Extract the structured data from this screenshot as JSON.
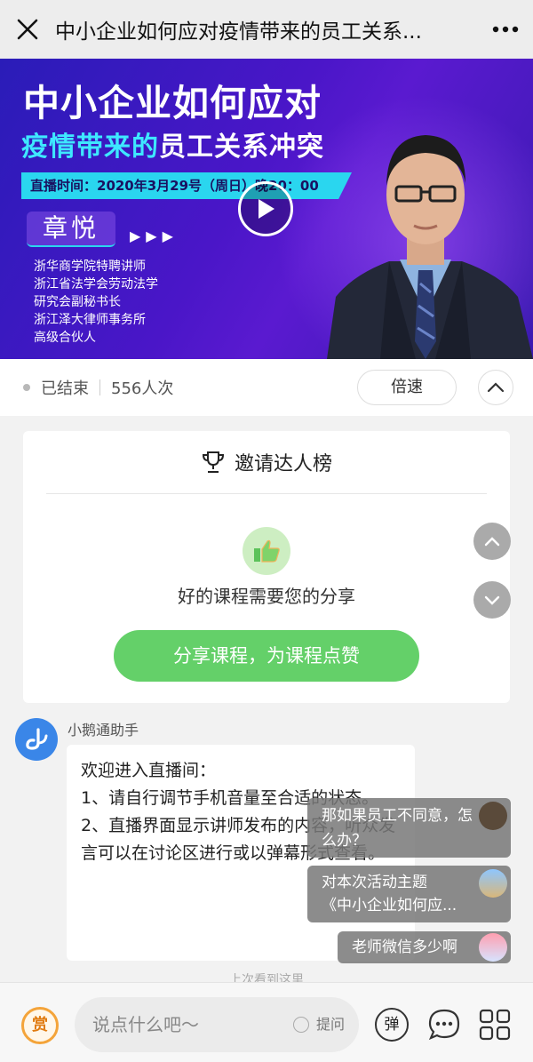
{
  "topbar": {
    "title": "中小企业如何应对疫情带来的员工关系..."
  },
  "banner": {
    "title_line1": "中小企业如何应对",
    "title_line2_highlight": "疫情带来的",
    "title_line2_rest": "员工关系冲突",
    "live_time": "直播时间：2020年3月29号（周日）晚20：00",
    "speaker_name": "章悦",
    "arrows": "▶▶▶",
    "speaker_titles": [
      "浙华商学院特聘讲师",
      "浙江省法学会劳动法学",
      "研究会副秘书长",
      "浙江泽大律师事务所",
      "高级合伙人"
    ]
  },
  "status": {
    "state": "已结束",
    "views": "556人次",
    "speed_label": "倍速"
  },
  "invite_card": {
    "title": "邀请达人榜",
    "message": "好的课程需要您的分享",
    "share_button": "分享课程，为课程点赞"
  },
  "chat": {
    "sender": "小鹅通助手",
    "message_lines": [
      "欢迎进入直播间：",
      "1、请自行调节手机音量至合适的状态。",
      "2、直播界面显示讲师发布的内容，听众发言可以在讨论区进行或以弹幕形式查看。"
    ],
    "last_seen": "上次看到这里"
  },
  "danmaku": [
    {
      "text": "那如果员工不同意，怎么办？"
    },
    {
      "text_line1": "对本次活动主题",
      "text_line2": "《中小企业如何应..."
    },
    {
      "text": "老师微信多少啊"
    }
  ],
  "bottombar": {
    "reward_label": "赏",
    "input_placeholder": "说点什么吧～",
    "ask_label": "提问",
    "danmu_label": "弹"
  },
  "colors": {
    "accent_green": "#64d069",
    "banner_cyan": "#2ad6ef",
    "banner_purple": "#4a16c8",
    "reward_orange": "#f4a43a",
    "avatar_blue": "#3a86e8"
  }
}
